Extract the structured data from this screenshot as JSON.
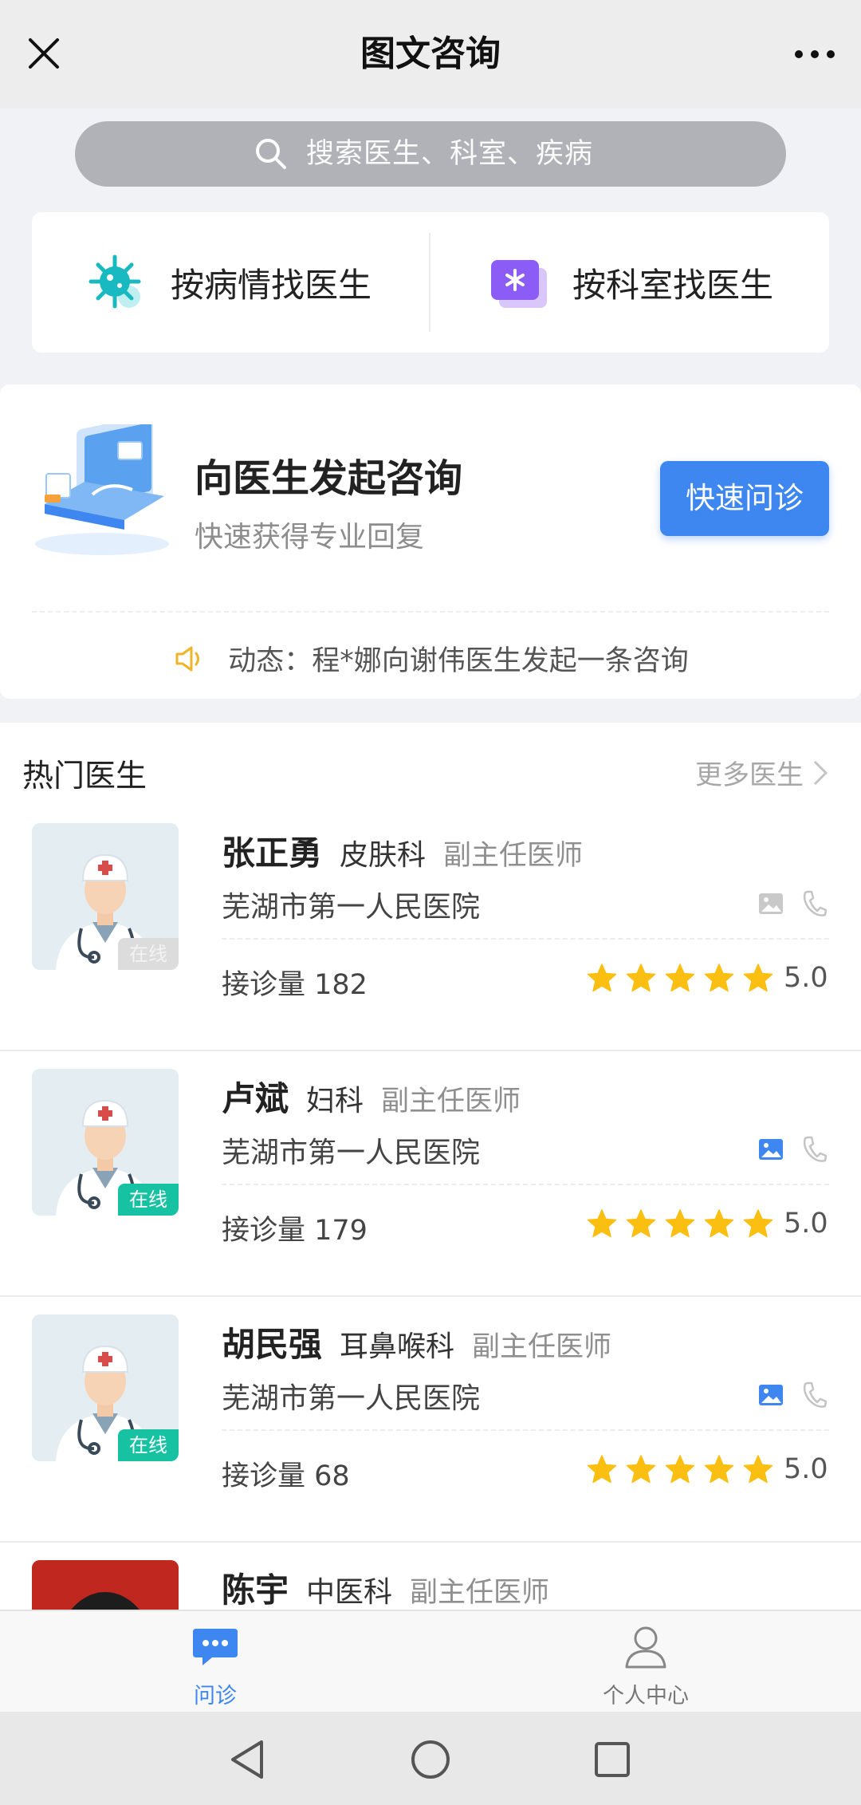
{
  "header": {
    "title": "图文咨询"
  },
  "search": {
    "placeholder": "搜索医生、科室、疾病"
  },
  "finder": {
    "by_condition": "按病情找医生",
    "by_department": "按科室找医生"
  },
  "consult": {
    "title": "向医生发起咨询",
    "subtitle": "快速获得专业回复",
    "button": "快速问诊",
    "news": "动态：程*娜向谢伟医生发起一条咨询"
  },
  "hot": {
    "title": "热门医生",
    "more": "更多医生",
    "doctors": [
      {
        "name": "张正勇",
        "dept": "皮肤科",
        "title": "副主任医师",
        "hospital": "芜湖市第一人民医院",
        "count_label": "接诊量 182",
        "rating": "5.0",
        "stars": 5,
        "status": "在线",
        "online": false,
        "image_consult": false
      },
      {
        "name": "卢斌",
        "dept": "妇科",
        "title": "副主任医师",
        "hospital": "芜湖市第一人民医院",
        "count_label": "接诊量 179",
        "rating": "5.0",
        "stars": 5,
        "status": "在线",
        "online": true,
        "image_consult": true
      },
      {
        "name": "胡民强",
        "dept": "耳鼻喉科",
        "title": "副主任医师",
        "hospital": "芜湖市第一人民医院",
        "count_label": "接诊量 68",
        "rating": "5.0",
        "stars": 5,
        "status": "在线",
        "online": true,
        "image_consult": true
      },
      {
        "name": "陈宇",
        "dept": "中医科",
        "title": "副主任医师"
      }
    ]
  },
  "tabbar": {
    "consult": "问诊",
    "profile": "个人中心"
  },
  "colors": {
    "accent": "#3e86f0",
    "online": "#16c2a1",
    "star": "#fbbf12"
  }
}
